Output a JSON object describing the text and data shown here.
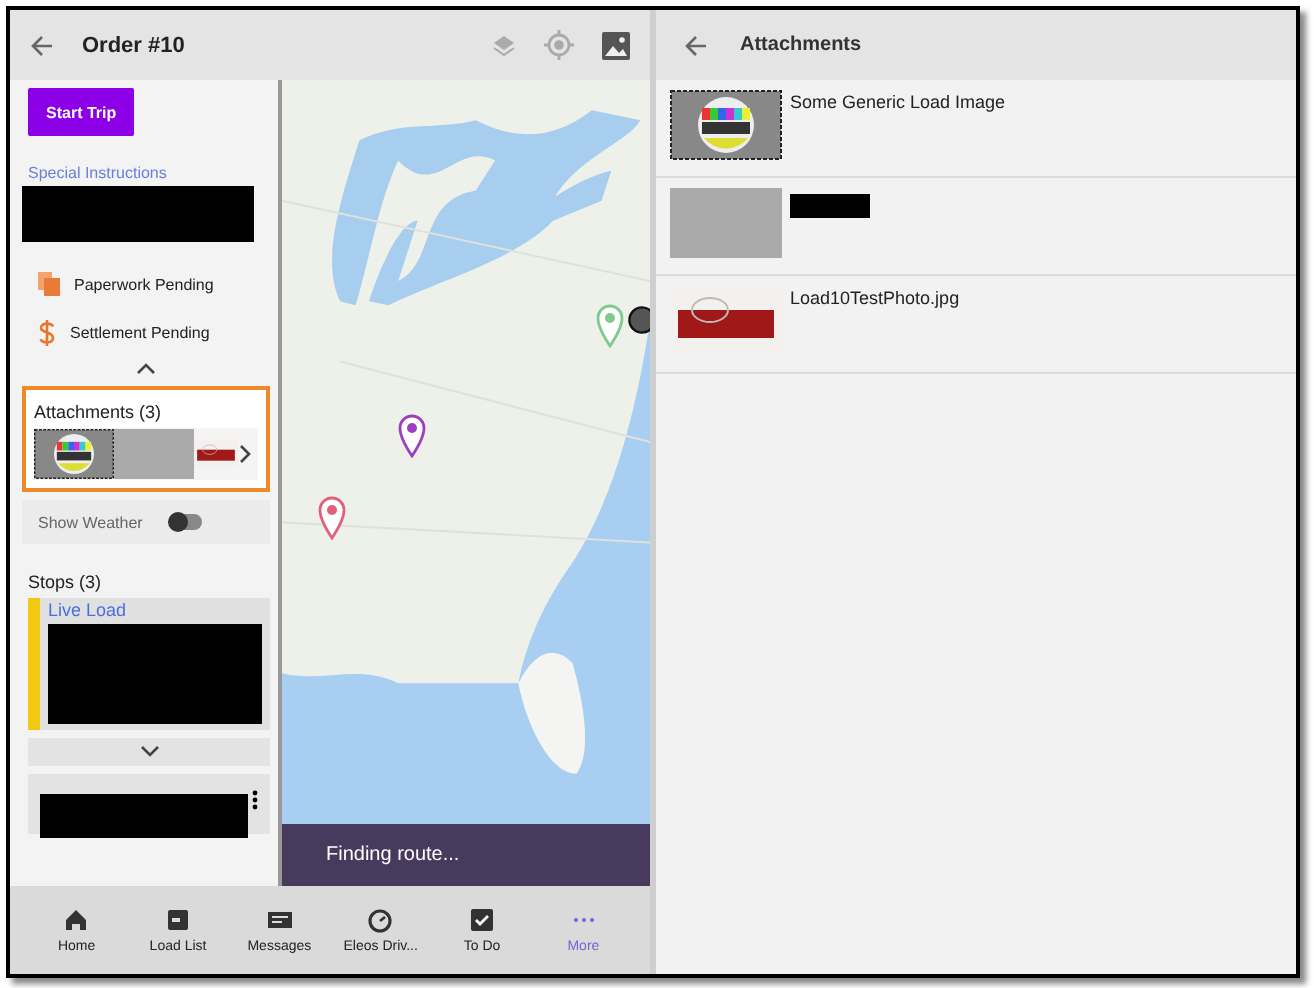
{
  "order_screen": {
    "header": {
      "title": "Order #10"
    },
    "start_trip_button": "Start Trip",
    "special_instructions": {
      "label": "Special Instructions",
      "redacted": true
    },
    "status_items": [
      {
        "kind": "paperwork",
        "label": "Paperwork Pending"
      },
      {
        "kind": "settlement",
        "label": "Settlement Pending"
      }
    ],
    "attachments_preview": {
      "title": "Attachments (3)",
      "highlighted": true
    },
    "show_weather": {
      "label": "Show Weather",
      "on": false
    },
    "stops": {
      "title": "Stops (3)",
      "items": [
        {
          "kind": "labeled",
          "label": "Live Load",
          "color": "#f2c811"
        },
        {
          "kind": "redacted"
        }
      ]
    },
    "map": {
      "status": "Finding route..."
    },
    "bottom_nav": [
      {
        "kind": "home",
        "label": "Home",
        "selected": false
      },
      {
        "kind": "load_list",
        "label": "Load List",
        "selected": false
      },
      {
        "kind": "messages",
        "label": "Messages",
        "selected": false
      },
      {
        "kind": "drive",
        "label": "Eleos Driv...",
        "selected": false
      },
      {
        "kind": "todo",
        "label": "To Do",
        "selected": false
      },
      {
        "kind": "more",
        "label": "More",
        "selected": true
      }
    ]
  },
  "attachments_screen": {
    "header": {
      "title": "Attachments"
    },
    "items": [
      {
        "kind": "test_pattern",
        "name": "Some Generic Load Image"
      },
      {
        "kind": "gray",
        "redacted": true
      },
      {
        "kind": "photo",
        "name": "Load10TestPhoto.jpg"
      }
    ]
  }
}
